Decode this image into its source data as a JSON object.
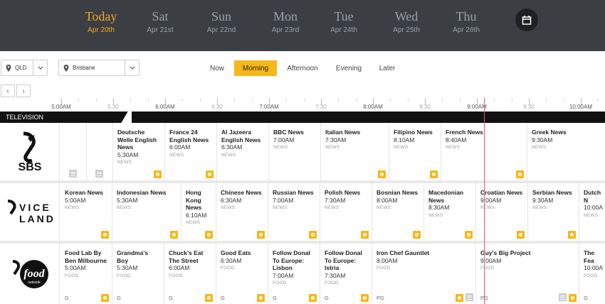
{
  "days": [
    {
      "name": "Today",
      "date": "Apr 20th"
    },
    {
      "name": "Sat",
      "date": "Apr 21st"
    },
    {
      "name": "Sun",
      "date": "Apr 22nd"
    },
    {
      "name": "Mon",
      "date": "Apr 23rd"
    },
    {
      "name": "Tue",
      "date": "Apr 24th"
    },
    {
      "name": "Wed",
      "date": "Apr 25th"
    },
    {
      "name": "Thu",
      "date": "Apr 26th"
    }
  ],
  "filters": {
    "state": "QLD",
    "city": "Brisbane"
  },
  "time_of_day": [
    "Now",
    "Morning",
    "Afternoon",
    "Evening",
    "Later"
  ],
  "active_time_of_day": "Morning",
  "ruler": {
    "labels": [
      "5:00AM",
      "5:30",
      "6:00AM",
      "6:30",
      "7:00AM",
      "7:30",
      "8:00AM",
      "8:30",
      "9:00AM",
      "9:30",
      "10:00AM"
    ]
  },
  "section_label": "TELEVISION",
  "channels": [
    {
      "name": "SBS",
      "programs": [
        {
          "title": "Deutsche Welle English News",
          "time": "5:30AM",
          "genre": "NEWS"
        },
        {
          "title": "France 24 English News",
          "time": "6:00AM",
          "genre": "NEWS"
        },
        {
          "title": "Al Jazeera English News",
          "time": "6:30AM",
          "genre": "NEWS"
        },
        {
          "title": "BBC News",
          "time": "7:00AM",
          "genre": "NEWS"
        },
        {
          "title": "Italian News",
          "time": "7:30AM",
          "genre": "NEWS"
        },
        {
          "title": "Filipino News",
          "time": "8:10AM",
          "genre": "NEWS"
        },
        {
          "title": "French News",
          "time": "8:40AM",
          "genre": "NEWS"
        },
        {
          "title": "Greek News",
          "time": "9:30AM",
          "genre": "NEWS"
        }
      ]
    },
    {
      "name": "VICELAND",
      "programs": [
        {
          "title": "Korean News",
          "time": "5:00AM",
          "genre": "NEWS"
        },
        {
          "title": "Indonesian News",
          "time": "5:30AM",
          "genre": "NEWS"
        },
        {
          "title": "Hong Kong News",
          "time": "6:10AM",
          "genre": "NEWS"
        },
        {
          "title": "Chinese News",
          "time": "6:30AM",
          "genre": "NEWS"
        },
        {
          "title": "Russian News",
          "time": "7:00AM",
          "genre": "NEWS"
        },
        {
          "title": "Polish News",
          "time": "7:30AM",
          "genre": "NEWS"
        },
        {
          "title": "Bosnian News",
          "time": "8:00AM",
          "genre": "NEWS"
        },
        {
          "title": "Macedonian News",
          "time": "8:30AM",
          "genre": "NEWS"
        },
        {
          "title": "Croatian News",
          "time": "9:00AM",
          "genre": "NEWS"
        },
        {
          "title": "Serbian News",
          "time": "9:30AM",
          "genre": "NEWS"
        },
        {
          "title": "Dutch N",
          "time": "10:00A",
          "genre": "NEWS"
        }
      ]
    },
    {
      "name": "food network",
      "programs": [
        {
          "title": "Food Lab By Ben Milbourne",
          "time": "5:00AM",
          "genre": "FOOD",
          "rating": "G"
        },
        {
          "title": "Grandma's Boy",
          "time": "5:30AM",
          "genre": "FOOD",
          "rating": "G"
        },
        {
          "title": "Chuck's Eat The Street",
          "time": "6:00AM",
          "genre": "FOOD",
          "rating": "G"
        },
        {
          "title": "Good Eats",
          "time": "6:30AM",
          "genre": "FOOD",
          "rating": "G"
        },
        {
          "title": "Follow Donal To Europe: Lisbon",
          "time": "7:00AM",
          "genre": "FOOD",
          "rating": "G"
        },
        {
          "title": "Follow Donal To Europe: Istria",
          "time": "7:30AM",
          "genre": "FOOD",
          "rating": "G"
        },
        {
          "title": "Iron Chef Gauntlet",
          "time": "8:00AM",
          "genre": "FOOD",
          "rating": "PG"
        },
        {
          "title": "Guy's Big Project",
          "time": "9:00AM",
          "genre": "FOOD",
          "rating": "PG"
        },
        {
          "title": "The Fea",
          "time": "10:00A",
          "genre": "FOOD",
          "rating": "G"
        }
      ]
    }
  ],
  "colors": {
    "header_bg": "#3b3f43",
    "accent": "#f5b819",
    "now_line": "#e25b5b"
  }
}
